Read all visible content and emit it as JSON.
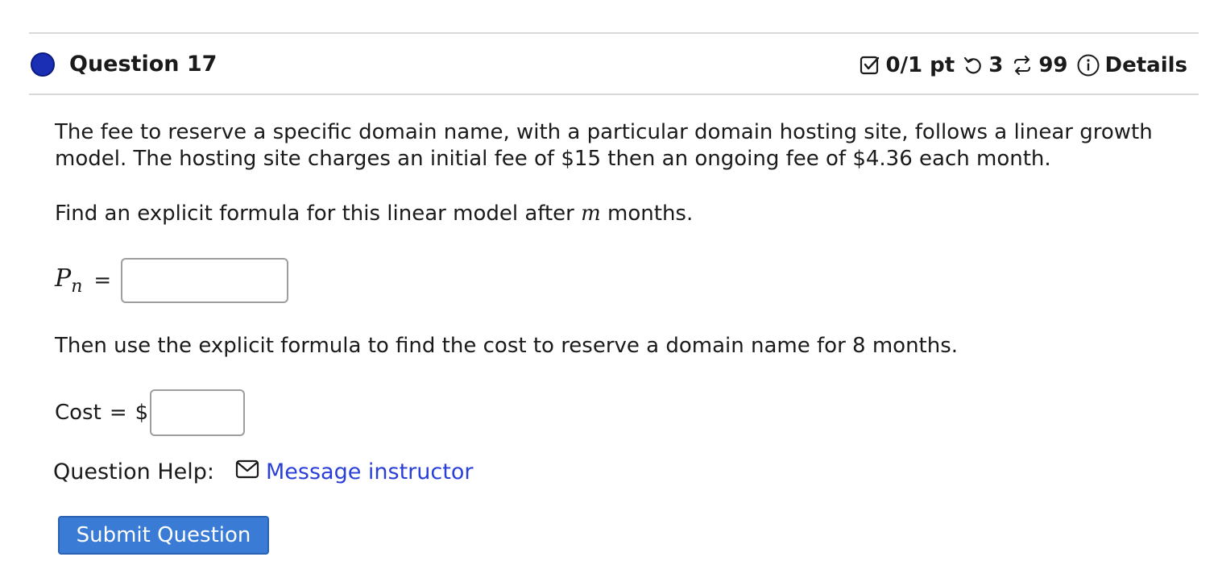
{
  "question": {
    "title": "Question 17",
    "score": "0/1 pt",
    "attempts_left": "3",
    "versions": "99",
    "details_label": "Details"
  },
  "prompt": {
    "text": "The fee to reserve a specific domain name, with a particular domain hosting site, follows a linear growth model. The hosting site charges an initial fee of $15 then an ongoing fee of $4.36 each month.",
    "find_prefix": "Find an explicit formula for this linear model after ",
    "find_var": "m",
    "find_suffix": " months."
  },
  "formula_input": {
    "label_main": "P",
    "label_sub": "n",
    "equals": "=",
    "value": ""
  },
  "cost_prompt": "Then use the explicit formula to find the cost to reserve a domain name for 8 months.",
  "cost_input": {
    "label": "Cost",
    "equals": "=",
    "currency": "$",
    "value": ""
  },
  "help": {
    "label": "Question Help:",
    "link_text": "Message instructor"
  },
  "submit_label": "Submit Question",
  "colors": {
    "status_dot": "#1b2fb5",
    "link": "#2a3fd8",
    "submit_bg": "#3a7bd5"
  },
  "icons": [
    "status-dot",
    "checkbox-icon",
    "retry-icon",
    "versions-icon",
    "info-icon",
    "mail-icon"
  ]
}
